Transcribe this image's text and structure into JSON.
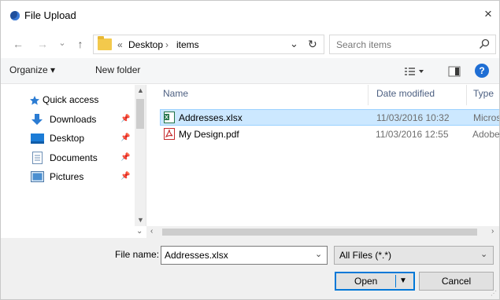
{
  "window": {
    "title": "File Upload",
    "close": "×"
  },
  "nav": {
    "back": "←",
    "forward": "→",
    "recent": "⌄",
    "up": "↑",
    "refresh": "↻",
    "dropdown": "⌄"
  },
  "address": {
    "overflow": "«",
    "path": [
      "Desktop",
      "items"
    ],
    "separator": "›"
  },
  "search": {
    "placeholder": "Search items"
  },
  "toolbar": {
    "organize": "Organize ▾",
    "new_folder": "New folder"
  },
  "sidebar": {
    "items": [
      {
        "label": "Quick access",
        "icon": "star-icon"
      },
      {
        "label": "Downloads",
        "icon": "download-arrow-icon",
        "pinned": true
      },
      {
        "label": "Desktop",
        "icon": "desktop-icon",
        "pinned": true
      },
      {
        "label": "Documents",
        "icon": "documents-icon",
        "pinned": true
      },
      {
        "label": "Pictures",
        "icon": "pictures-icon",
        "pinned": true
      }
    ]
  },
  "columns": {
    "name": "Name",
    "date": "Date modified",
    "type": "Type"
  },
  "files": [
    {
      "name": "Addresses.xlsx",
      "date": "11/03/2016 10:32",
      "type": "Micros",
      "icon": "excel-icon",
      "selected": true
    },
    {
      "name": "My Design.pdf",
      "date": "11/03/2016 12:55",
      "type": "Adobe",
      "icon": "pdf-icon",
      "selected": false
    }
  ],
  "bottom": {
    "filename_label": "File name:",
    "filename_value": "Addresses.xlsx",
    "filetype_value": "All Files (*.*)",
    "open_label": "Open",
    "cancel_label": "Cancel"
  },
  "colors": {
    "accent": "#0078d7",
    "selection": "#cce8ff",
    "selection_border": "#99d1ff",
    "help": "#1f6ed4"
  }
}
